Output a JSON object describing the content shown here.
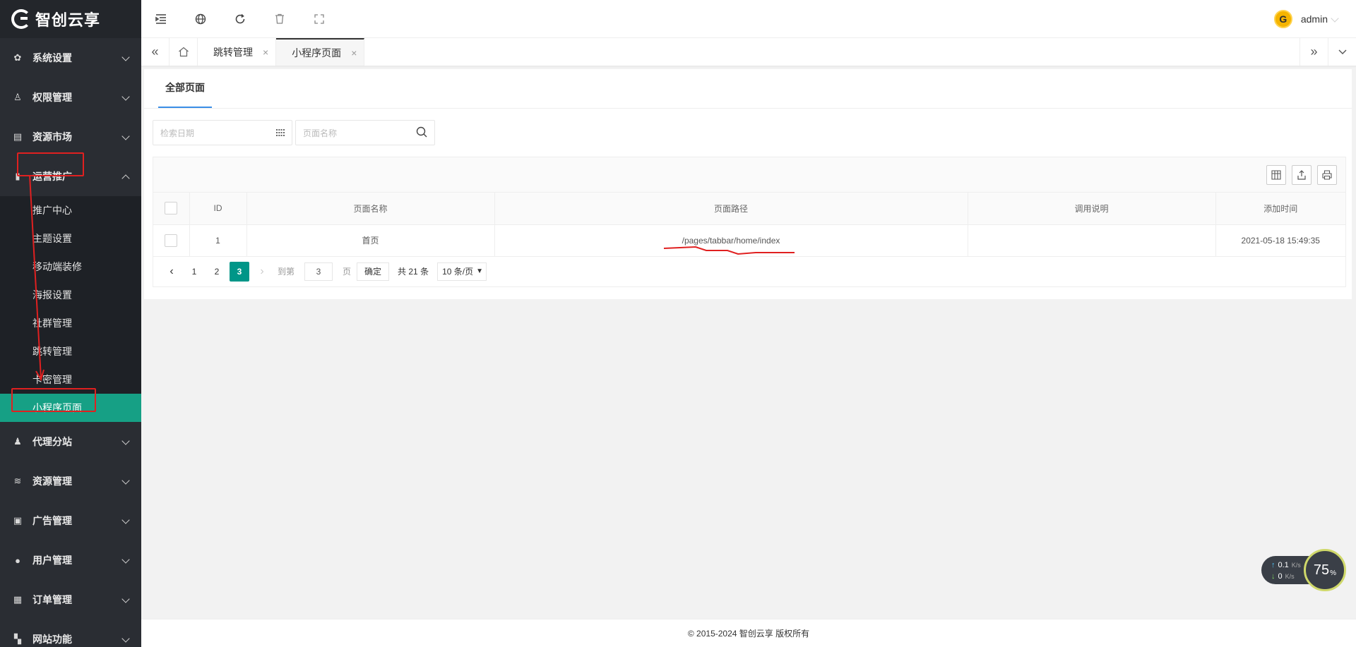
{
  "app": {
    "logo_text": "智创云享"
  },
  "sidebar": {
    "items": [
      {
        "label": "系统设置",
        "icon": "gear-icon",
        "glyph": "✿"
      },
      {
        "label": "权限管理",
        "icon": "user-key-icon",
        "glyph": "♙"
      },
      {
        "label": "资源市场",
        "icon": "store-icon",
        "glyph": "▤"
      },
      {
        "label": "运营推广",
        "icon": "flag-icon",
        "glyph": "▮"
      },
      {
        "label": "代理分站",
        "icon": "agent-icon",
        "glyph": "♟"
      },
      {
        "label": "资源管理",
        "icon": "layers-icon",
        "glyph": "≋"
      },
      {
        "label": "广告管理",
        "icon": "ad-icon",
        "glyph": "▣"
      },
      {
        "label": "用户管理",
        "icon": "user-icon",
        "glyph": "●"
      },
      {
        "label": "订单管理",
        "icon": "order-icon",
        "glyph": "▦"
      },
      {
        "label": "网站功能",
        "icon": "grid-icon",
        "glyph": "▚"
      }
    ],
    "submenu": [
      "推广中心",
      "主题设置",
      "移动端装修",
      "海报设置",
      "社群管理",
      "跳转管理",
      "卡密管理",
      "小程序页面"
    ],
    "active_sub": "小程序页面"
  },
  "topbar": {
    "icons": [
      "menu-fold-icon",
      "globe-icon",
      "refresh-icon",
      "trash-icon",
      "fullscreen-icon"
    ],
    "user_name": "admin",
    "avatar_letter": "G"
  },
  "tabs": {
    "items": [
      {
        "label": "跳转管理",
        "close": "×"
      },
      {
        "label": "小程序页面",
        "close": "×"
      }
    ]
  },
  "page": {
    "tab_label": "全部页面",
    "filters": {
      "date_placeholder": "检索日期",
      "name_placeholder": "页面名称"
    },
    "table": {
      "headers": [
        "ID",
        "页面名称",
        "页面路径",
        "调用说明",
        "添加时间"
      ],
      "rows": [
        {
          "id": "1",
          "name": "首页",
          "path": "/pages/tabbar/home/index",
          "desc": "",
          "time": "2021-05-18 15:49:35"
        }
      ]
    },
    "pager": {
      "pages": [
        "1",
        "2",
        "3"
      ],
      "current": "3",
      "goto_label": "到第",
      "goto_value": "3",
      "page_unit": "页",
      "confirm": "确定",
      "total": "共 21 条",
      "page_size": "10 条/页"
    }
  },
  "footer": {
    "copyright": "© 2015-2024 智创云享 版权所有"
  },
  "net_widget": {
    "up": "0.1",
    "down": "0",
    "unit": "K/s",
    "percent": "75",
    "percent_unit": "%"
  },
  "colors": {
    "sidebar_bg": "#2a2d33",
    "active": "#16a085",
    "accent": "#009688",
    "annotation": "#e02020"
  }
}
